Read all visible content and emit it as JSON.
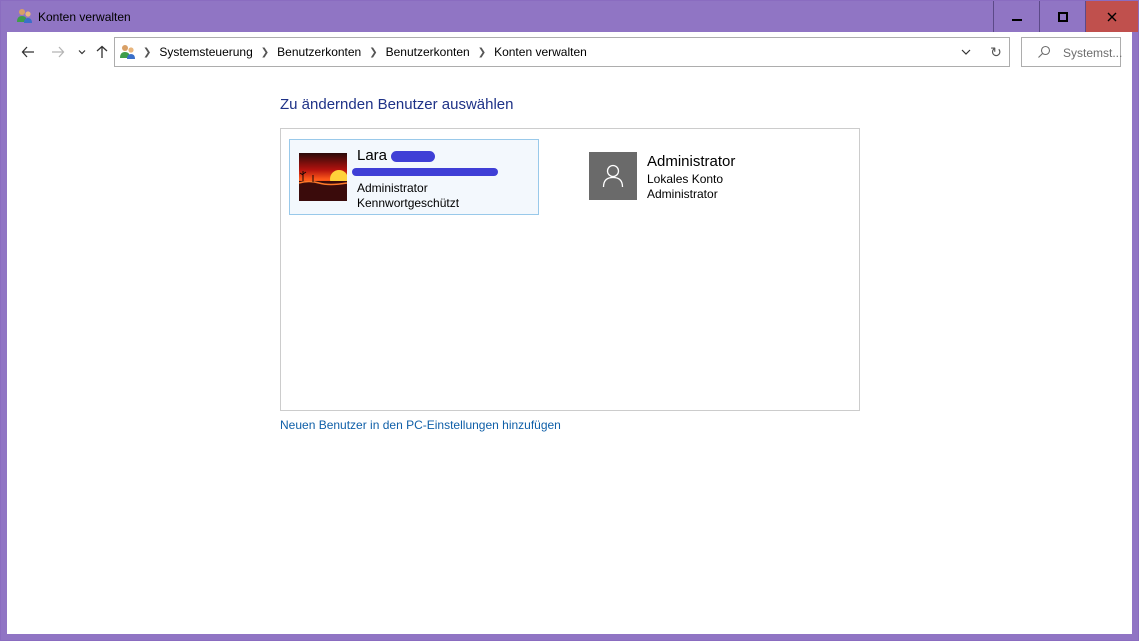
{
  "window": {
    "title": "Konten verwalten"
  },
  "navbar": {
    "breadcrumbs": [
      "Systemsteuerung",
      "Benutzerkonten",
      "Benutzerkonten",
      "Konten verwalten"
    ],
    "search_placeholder": "Systemst..."
  },
  "main": {
    "heading": "Zu ändernden Benutzer auswählen",
    "users": [
      {
        "name": "Lara",
        "line1": "Administrator",
        "line2": "Kennwortgeschützt",
        "selected": true
      },
      {
        "name": "Administrator",
        "line1": "Lokales Konto",
        "line2": "Administrator",
        "selected": false
      }
    ],
    "add_user_link": "Neuen Benutzer in den PC-Einstellungen hinzufügen"
  },
  "colors": {
    "titlebar": "#9075c4",
    "close_button": "#c0504d",
    "heading": "#1e3287",
    "link": "#0f5fa8",
    "redaction": "#3f3fd6"
  }
}
